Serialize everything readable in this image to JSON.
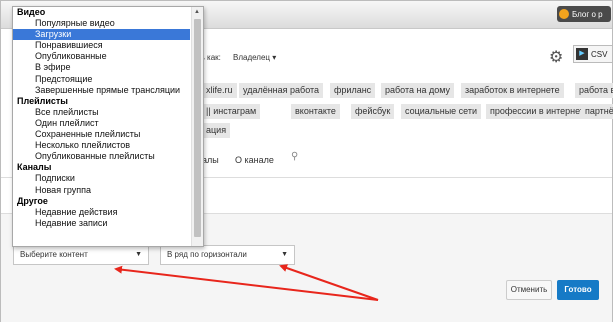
{
  "header": {
    "blog_label": "Блог о р"
  },
  "toolbar": {
    "sort_label": "ть как:",
    "sort_value": "Владелец",
    "csv_label": "CSV"
  },
  "tags_row1": [
    "xlife.ru",
    "удалённая работа",
    "фриланс",
    "работа на дому",
    "заработок в интернете",
    "работа в"
  ],
  "tags_row2": [
    "инстаграм",
    "вконтакте",
    "фейсбук",
    "социальные сети",
    "профессии в интернете",
    "партнё"
  ],
  "tags_row3": [
    "ация"
  ],
  "tabs": {
    "channels_partial": "алы",
    "about": "О канале"
  },
  "dropdown": {
    "groups": [
      {
        "label": "Видео",
        "items": [
          "Популярные видео",
          "Загрузки",
          "Понравившиеся",
          "Опубликованные",
          "В эфире",
          "Предстоящие",
          "Завершенные прямые трансляции"
        ]
      },
      {
        "label": "Плейлисты",
        "items": [
          "Все плейлисты",
          "Один плейлист",
          "Сохраненные плейлисты",
          "Несколько плейлистов",
          "Опубликованные плейлисты"
        ]
      },
      {
        "label": "Каналы",
        "items": [
          "Подписки",
          "Новая группа"
        ]
      },
      {
        "label": "Другое",
        "items": [
          "Недавние действия",
          "Недавние записи"
        ]
      }
    ],
    "selected": "Загрузки"
  },
  "content_select": {
    "value": "Выберите контент"
  },
  "layout_select": {
    "value": "В ряд по горизонтали"
  },
  "buttons": {
    "cancel": "Отменить",
    "done": "Готово"
  },
  "colors": {
    "accent": "#167ac6",
    "selection": "#3a78d8",
    "arrow": "#e8261c"
  }
}
